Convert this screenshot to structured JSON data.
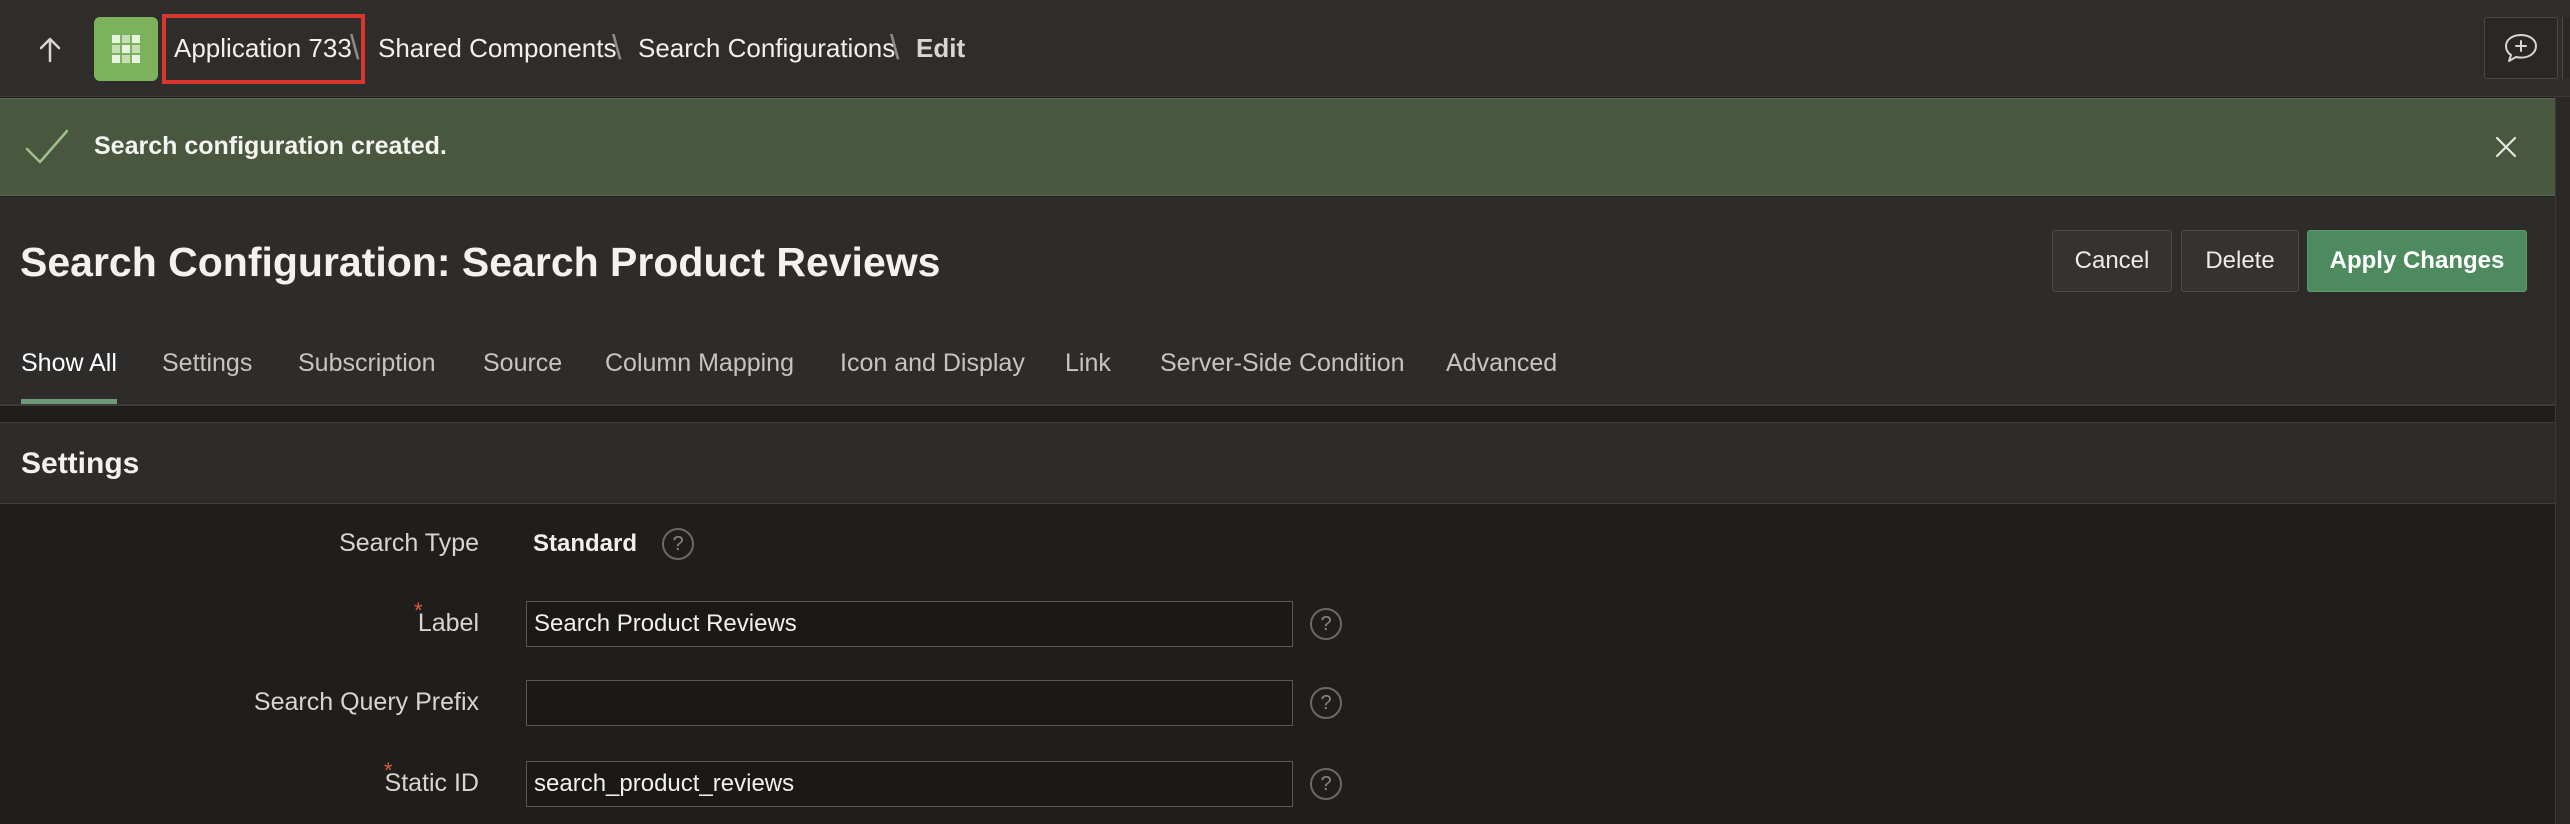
{
  "topbar": {
    "up_icon": "arrow-up-icon",
    "app_icon": "application-grid-icon",
    "breadcrumbs": [
      "Application 733",
      "Shared Components",
      "Search Configurations",
      "Edit"
    ],
    "separator": "\\",
    "feedback_icon": "feedback-chat-icon"
  },
  "banner": {
    "message": "Search configuration created.",
    "check_icon": "checkmark-icon",
    "close_icon": "close-icon"
  },
  "page": {
    "title": "Search Configuration: Search Product Reviews",
    "buttons": {
      "cancel": "Cancel",
      "delete": "Delete",
      "apply": "Apply Changes"
    },
    "tabs": [
      "Show All",
      "Settings",
      "Subscription",
      "Source",
      "Column Mapping",
      "Icon and Display",
      "Link",
      "Server-Side Condition",
      "Advanced"
    ],
    "active_tab": "Show All"
  },
  "settings": {
    "section_title": "Settings",
    "search_type": {
      "label": "Search Type",
      "value": "Standard"
    },
    "label_field": {
      "label": "Label",
      "value": "Search Product Reviews",
      "required": "*"
    },
    "prefix_field": {
      "label": "Search Query Prefix",
      "value": ""
    },
    "static_id_field": {
      "label": "Static ID",
      "value": "search_product_reviews",
      "required": "*"
    },
    "help_glyph": "?"
  },
  "colors": {
    "accent_green": "#4d8a5e",
    "banner_bg": "#48573d",
    "highlight_red": "#d9352b",
    "required_red": "#e0593f"
  }
}
